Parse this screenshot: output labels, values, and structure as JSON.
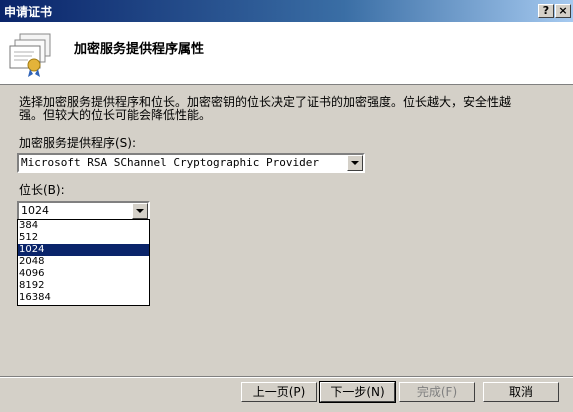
{
  "window": {
    "title": "申请证书"
  },
  "header": {
    "title": "加密服务提供程序属性"
  },
  "description": "选择加密服务提供程序和位长。加密密钥的位长决定了证书的加密强度。位长越大，安全性越强。但较大的位长可能会降低性能。",
  "csp": {
    "label": "加密服务提供程序(S):",
    "selected": "Microsoft RSA SChannel Cryptographic Provider"
  },
  "keylength": {
    "label": "位长(B):",
    "selected": "1024",
    "options": [
      "384",
      "512",
      "1024",
      "2048",
      "4096",
      "8192",
      "16384"
    ]
  },
  "buttons": {
    "back": "上一页(P)",
    "next": "下一步(N)",
    "finish": "完成(F)",
    "cancel": "取消"
  },
  "titlebar_buttons": {
    "help": "?",
    "close": "×"
  }
}
